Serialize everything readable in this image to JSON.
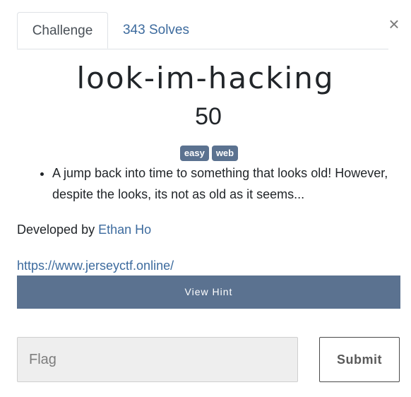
{
  "tabs": [
    {
      "label": "Challenge",
      "active": true
    },
    {
      "label": "343 Solves",
      "active": false
    }
  ],
  "close_symbol": "×",
  "challenge": {
    "name": "look-im-hacking",
    "value": "50",
    "tags": [
      "easy",
      "web"
    ],
    "description": "A jump back into time to something that looks old! However, despite the looks, its not as old as it seems...",
    "developer_prefix": "Developed by",
    "developer_name": "Ethan Ho",
    "url": "https://www.jerseyctf.online/"
  },
  "hint_button_label": "View Hint",
  "flag_input": {
    "placeholder": "Flag",
    "value": ""
  },
  "submit_label": "Submit",
  "colors": {
    "accent": "#5b7290",
    "link": "#3d6b9e"
  }
}
